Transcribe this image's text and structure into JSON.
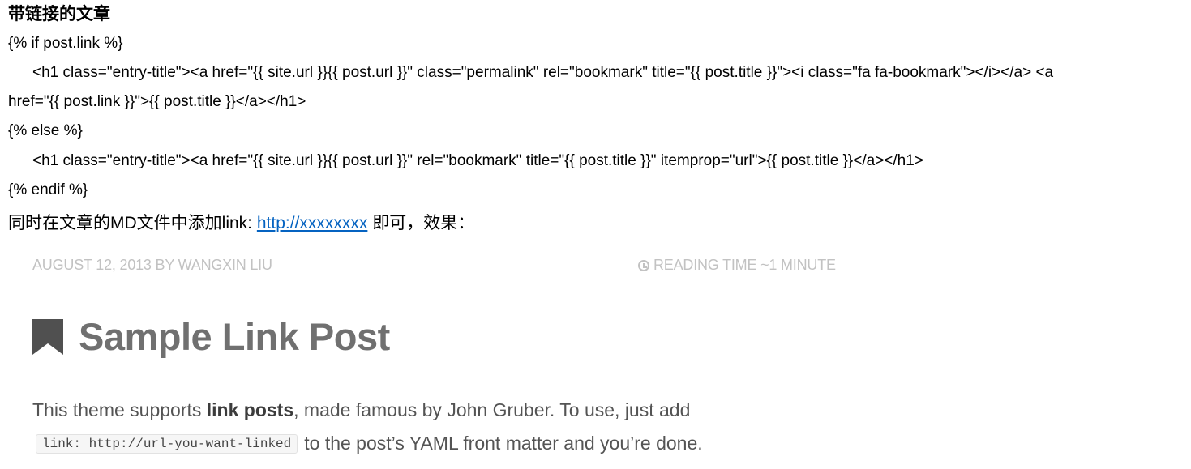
{
  "section_title": "带链接的文章",
  "code_lines": [
    "{% if post.link %}",
    "<h1 class=\"entry-title\"><a href=\"{{ site.url }}{{ post.url }}\" class=\"permalink\" rel=\"bookmark\" title=\"{{ post.title }}\"><i class=\"fa fa-bookmark\"></i></a> <a",
    "href=\"{{ post.link }}\">{{ post.title }}</a></h1>",
    "{% else %}",
    "<h1 class=\"entry-title\"><a href=\"{{ site.url }}{{ post.url }}\" rel=\"bookmark\" title=\"{{ post.title }}\" itemprop=\"url\">{{ post.title }}</a></h1>",
    "{% endif %}"
  ],
  "instruction": {
    "prefix": "同时在文章的MD文件中添加link: ",
    "link_text": "http://xxxxxxxx",
    "suffix": " 即可，效果："
  },
  "preview": {
    "meta_left": "AUGUST 12, 2013 BY WANGXIN LIU",
    "meta_right": "READING TIME ~1 MINUTE",
    "title": "Sample Link Post",
    "body1_before": "This theme supports ",
    "body1_bold": "link posts",
    "body1_after": ", made famous by John Gruber. To use, just add",
    "code": "link: http://url-you-want-linked",
    "body2_after": "to the post’s YAML front matter and you’re done.",
    "colors": {
      "meta": "#c2c2c2",
      "title": "#707070",
      "body": "#545454",
      "link": "#0563c1"
    }
  }
}
